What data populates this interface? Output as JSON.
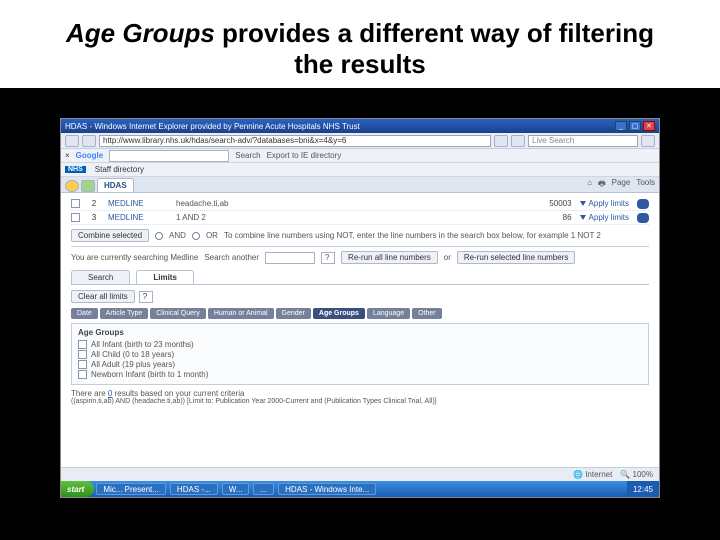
{
  "slide": {
    "title_em": "Age Groups",
    "title_rest": " provides a different way of filtering the results"
  },
  "browser": {
    "window_title": "HDAS - Windows Internet Explorer provided by Pennine Acute Hospitals NHS Trust",
    "url": "http://www.library.nhs.uk/hdas/search-adv/?databases=bni&x=4&y=6",
    "live_search": "Live Search",
    "google": "Google",
    "gitems": [
      "Search",
      "Export to IE directory"
    ],
    "nhs_tab": "Staff directory",
    "hdas_tab": "HDAS",
    "tools": [
      "Page",
      "Tools"
    ]
  },
  "results": [
    {
      "n": "2",
      "db": "MEDLINE",
      "term": "headache.ti,ab",
      "hits": "50003",
      "apply": "Apply limits"
    },
    {
      "n": "3",
      "db": "MEDLINE",
      "term": "1 AND 2",
      "hits": "86",
      "apply": "Apply limits"
    }
  ],
  "combine": {
    "btn": "Combine selected",
    "and": "AND",
    "or": "OR",
    "hint": "To combine line numbers using NOT, enter the line numbers in the search box below, for example 1 NOT 2"
  },
  "rerun": {
    "prefix": "You are currently searching Medline",
    "label": "Search another",
    "opt": "?",
    "btn1": "Re-run all line numbers",
    "or": "or",
    "btn2": "Re-run selected line numbers"
  },
  "tabs": {
    "search": "Search",
    "limits": "Limits"
  },
  "limits": {
    "clear": "Clear all limits",
    "box": "?"
  },
  "filters": [
    "Date",
    "Article Type",
    "Clinical Query",
    "Human or Animal",
    "Gender",
    "Age Groups",
    "Language",
    "Other"
  ],
  "age": {
    "title": "Age Groups",
    "items": [
      "All Infant (birth to 23 months)",
      "All Child (0 to 18 years)",
      "All Adult (19 plus years)",
      "Newborn Infant (birth to 1 month)"
    ]
  },
  "footer": {
    "count": "0",
    "line1a": "There are ",
    "line1b": " results based on your current criteria",
    "line2": "((aspirin.ti,ab) AND (headache.ti,ab)) [Limit to: Publication Year 2000-Current and (Publication Types Clinical Trial, All)]"
  },
  "status": {
    "zone": "Internet",
    "zoom": "100%"
  },
  "taskbar": {
    "start": "start",
    "items": [
      "Mic... Present...",
      "HDAS -...",
      "W...",
      "...",
      "HDAS - Windows Inte..."
    ],
    "time": "12:45"
  }
}
